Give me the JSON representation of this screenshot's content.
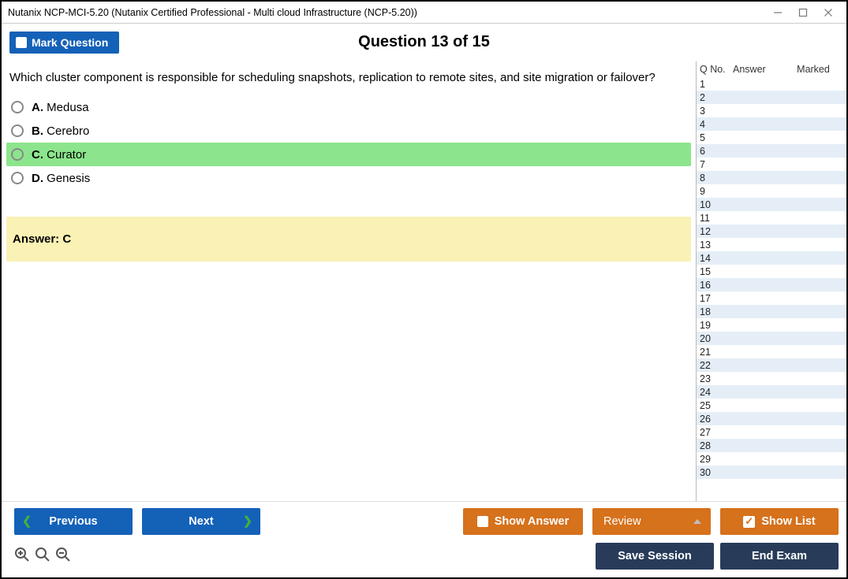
{
  "window": {
    "title": "Nutanix NCP-MCI-5.20 (Nutanix Certified Professional - Multi cloud Infrastructure (NCP-5.20))"
  },
  "header": {
    "mark_btn": "Mark Question",
    "counter": "Question 13 of 15"
  },
  "question": {
    "text": "Which cluster component is responsible for scheduling snapshots, replication to remote sites, and site migration or failover?",
    "options": [
      {
        "letter": "A.",
        "label": "Medusa",
        "highlight": false
      },
      {
        "letter": "B.",
        "label": "Cerebro",
        "highlight": false
      },
      {
        "letter": "C.",
        "label": "Curator",
        "highlight": true
      },
      {
        "letter": "D.",
        "label": "Genesis",
        "highlight": false
      }
    ],
    "answer_label": "Answer: C"
  },
  "sidebar": {
    "headers": {
      "qno": "Q No.",
      "answer": "Answer",
      "marked": "Marked"
    },
    "count": 30
  },
  "footer": {
    "previous": "Previous",
    "next": "Next",
    "show_answer": "Show Answer",
    "review": "Review",
    "show_list": "Show List",
    "save_session": "Save Session",
    "end_exam": "End Exam"
  }
}
